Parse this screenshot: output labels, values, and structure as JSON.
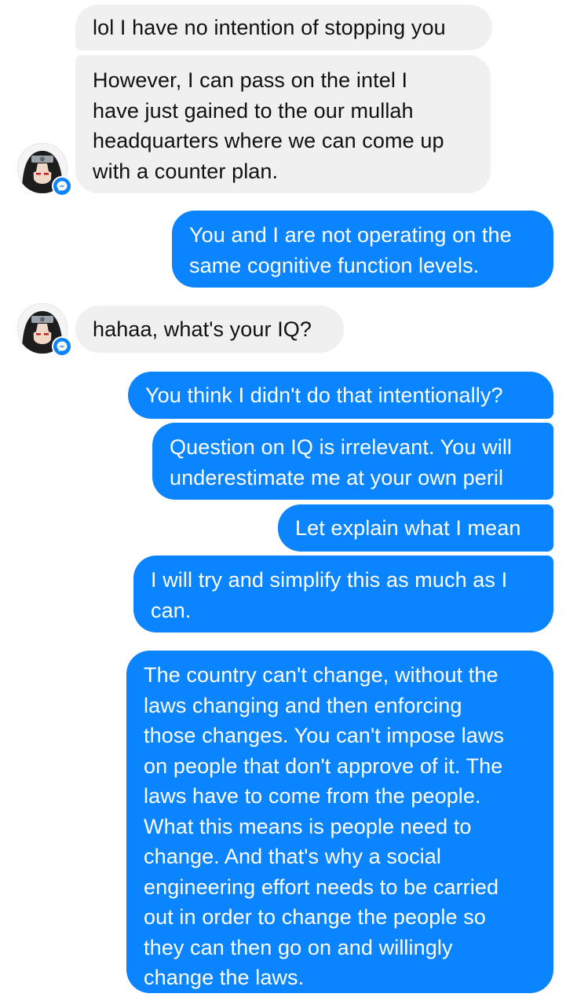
{
  "messages": [
    {
      "sender": "them",
      "text": "lol I have no intention of stopping you"
    },
    {
      "sender": "them",
      "text": "However, I can pass on the intel I\nhave just gained to the our mullah\nheadquarters where we can come up\nwith a counter plan."
    },
    {
      "sender": "me",
      "text": "You and I are not operating on the\nsame cognitive function levels."
    },
    {
      "sender": "them",
      "text": "hahaa, what's your IQ?"
    },
    {
      "sender": "me",
      "text": "You think I didn't do that intentionally?"
    },
    {
      "sender": "me",
      "text": "Question on IQ is irrelevant. You will\nunderestimate me at your own peril"
    },
    {
      "sender": "me",
      "text": "Let explain what I mean"
    },
    {
      "sender": "me",
      "text": "I will try and simplify this as much as I\ncan."
    },
    {
      "sender": "me",
      "text": "The country can't change, without the\nlaws changing and then enforcing\nthose changes. You can't impose laws\non people that don't approve of it. The\nlaws have to come from the people.\nWhat this means is people need to\nchange. And that's why a social\nengineering effort needs to be carried\nout in order to change the people so\nthey can then go on and willingly\nchange the laws."
    }
  ],
  "icons": {
    "avatar": "contact-avatar-icon",
    "badge": "messenger-badge-icon"
  },
  "colors": {
    "outgoing_bubble": "#0a84ff",
    "incoming_bubble": "#f0f0f0",
    "outgoing_text": "#ffffff",
    "incoming_text": "#111111"
  }
}
